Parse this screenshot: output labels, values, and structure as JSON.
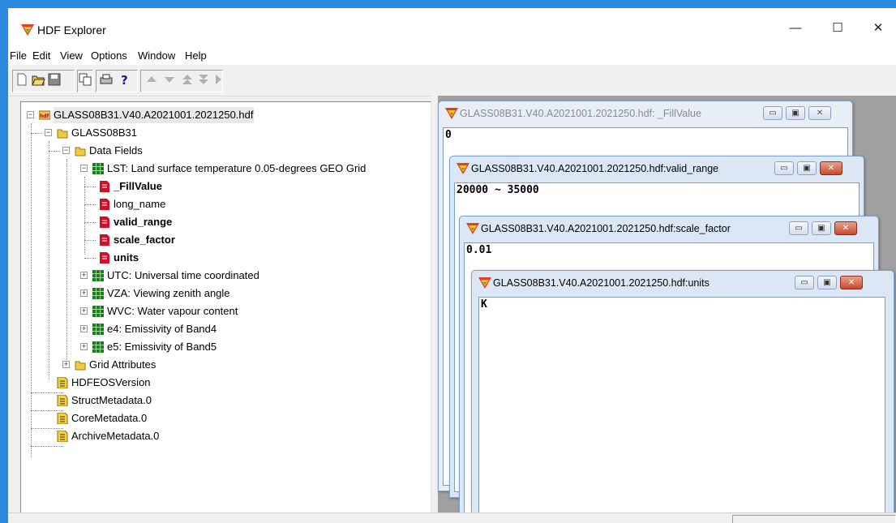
{
  "window": {
    "title": "HDF Explorer",
    "minimize": "—",
    "maximize": "☐",
    "close": "✕"
  },
  "menu": [
    "File",
    "Edit",
    "View",
    "Options",
    "Window",
    "Help"
  ],
  "tree": {
    "root": "GLASS08B31.V40.A2021001.2021250.hdf",
    "grid": "GLASS08B31",
    "data_fields": "Data Fields",
    "lst": "LST: Land surface temperature 0.05-degrees GEO Grid",
    "lst_attrs": [
      "_FillValue",
      "long_name",
      "valid_range",
      "scale_factor",
      "units"
    ],
    "fields": [
      "UTC: Universal time coordinated",
      "VZA: Viewing zenith angle",
      "WVC: Water vapour content",
      "e4: Emissivity of Band4",
      "e5: Emissivity of Band5"
    ],
    "grid_attributes": "Grid Attributes",
    "root_attrs": [
      "HDFEOSVersion",
      "StructMetadata.0",
      "CoreMetadata.0",
      "ArchiveMetadata.0"
    ]
  },
  "child_windows": [
    {
      "title": "GLASS08B31.V40.A2021001.2021250.hdf: _FillValue",
      "value": "0"
    },
    {
      "title": "GLASS08B31.V40.A2021001.2021250.hdf:valid_range",
      "value": "20000 ~ 35000"
    },
    {
      "title": "GLASS08B31.V40.A2021001.2021250.hdf:scale_factor",
      "value": "0.01"
    },
    {
      "title": "GLASS08B31.V40.A2021001.2021250.hdf:units",
      "value": "K"
    }
  ],
  "colors": {
    "accent": "#2a8ae0",
    "attr_icon": "#d0102a",
    "field_icon": "#1f7a1f",
    "folder": "#f2c744"
  }
}
